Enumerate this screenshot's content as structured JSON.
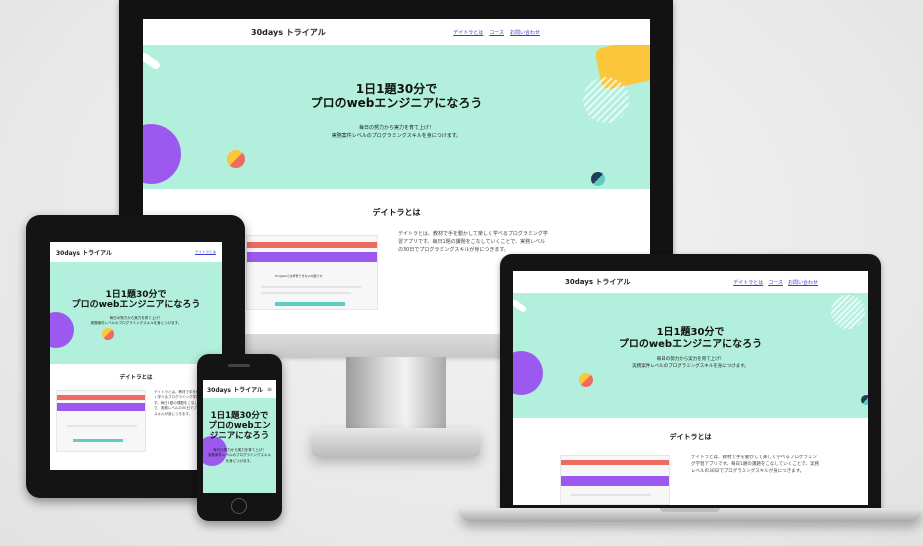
{
  "site": {
    "brand": "30days トライアル",
    "nav": [
      "デイトラとは",
      "コース",
      "お問い合わせ"
    ],
    "hero_title_1": "1日1題30分で",
    "hero_title_2": "プロのwebエンジニアになろう",
    "hero_sub_1": "毎日の努力から実力を育て上げ！",
    "hero_sub_2": "実務案件レベルのプログラミングスキルを身につけます。",
    "section_title": "デイトラとは",
    "about": "デイトラとは、教材で手を動かして楽しく学べるプログラミング学習アプリです。毎日1題の課題をこなしていくことで、実務レベルの30日でプログラミングスキルが身につきます。",
    "card_title": "Progateでは学習できない内容です",
    "phone_title_1": "1日1題30分で",
    "phone_title_2": "プロのwebエン",
    "phone_title_3": "ジニアになろう"
  },
  "colors": {
    "hero": "#b2efdd",
    "purple": "#9b59f0",
    "coral": "#ee6b62",
    "yellow": "#fbc53c",
    "teal": "#5ccfc0",
    "link": "#3a3ad8"
  }
}
